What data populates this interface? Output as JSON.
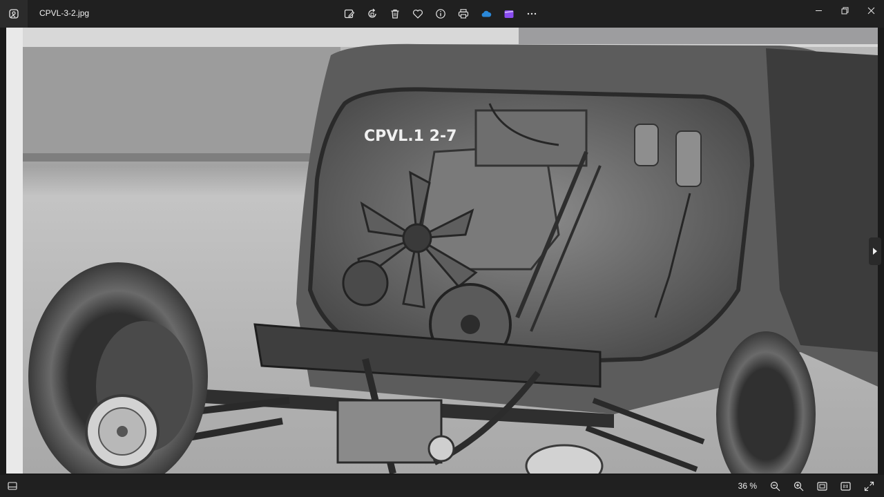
{
  "window": {
    "file_name": "CPVL-3-2.jpg"
  },
  "toolbar": {
    "buttons": [
      {
        "name": "edit-image-button",
        "icon": "edit-image-icon",
        "label": "Edit image"
      },
      {
        "name": "rotate-button",
        "icon": "rotate-icon",
        "label": "Rotate"
      },
      {
        "name": "delete-button",
        "icon": "trash-icon",
        "label": "Delete"
      },
      {
        "name": "favorite-button",
        "icon": "heart-icon",
        "label": "Favorite"
      },
      {
        "name": "file-info-button",
        "icon": "info-icon",
        "label": "File information"
      },
      {
        "name": "print-button",
        "icon": "printer-icon",
        "label": "Print"
      },
      {
        "name": "onedrive-button",
        "icon": "cloud-icon",
        "label": "OneDrive"
      },
      {
        "name": "clipchamp-button",
        "icon": "clipchamp-icon",
        "label": "Clipchamp"
      },
      {
        "name": "more-button",
        "icon": "more-icon",
        "label": "See more"
      }
    ],
    "accent_cloud": "#2b88d8",
    "accent_clipchamp": "#8a4cf0"
  },
  "photo": {
    "stencil_text": "CPVL.1 2-7"
  },
  "status": {
    "zoom_level": "36 %"
  }
}
